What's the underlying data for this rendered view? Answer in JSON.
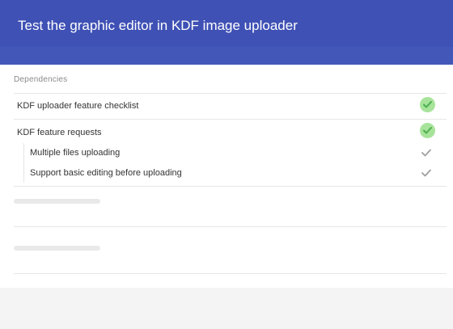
{
  "header": {
    "title": "Test the graphic editor in KDF image uploader"
  },
  "dependencies": {
    "label": "Dependencies",
    "items": [
      {
        "label": "KDF uploader feature checklist",
        "status_icon": "check-circle-icon"
      },
      {
        "label": "KDF feature requests",
        "status_icon": "check-circle-icon",
        "children": [
          {
            "label": "Multiple files uploading",
            "status_icon": "check-icon"
          },
          {
            "label": "Support basic editing before uploading",
            "status_icon": "check-icon"
          }
        ]
      }
    ]
  },
  "colors": {
    "header_bg": "#3f51b5",
    "check_circle_bg": "#a7e39a",
    "check_mark": "#4caf50",
    "check_plain": "#a0a0a0"
  }
}
